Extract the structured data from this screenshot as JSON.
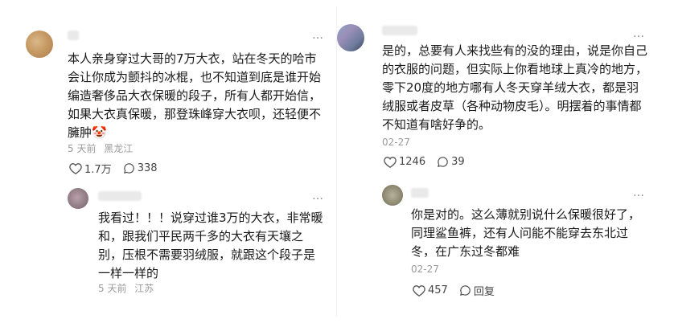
{
  "comments": [
    {
      "text": "本人亲身穿过大哥的7万大衣，站在冬天的哈市会让你成为颤抖的冰棍，也不知道到底是谁开始编造奢侈品大衣保暖的段子，所有人都开始信，如果大衣真保暖，那登珠峰穿大衣呗，还轻便不臃肿🤡",
      "time": "5 天前",
      "location": "黑龙江",
      "likes": "1.7万",
      "replies": "338"
    },
    {
      "text": "我看过！！！说穿过谁3万的大衣，非常暖和，跟我们平民两千多的大衣有天壤之别，压根不需要羽绒服，就跟这个段子是一样一样的",
      "time": "5 天前",
      "location": "江苏"
    },
    {
      "text": "是的，总要有人来找些有的没的理由，说是你自己的衣服的问题，但实际上你看地球上真冷的地方，零下20度的地方哪有人冬天穿羊绒大衣，都是羽绒服或者皮草（各种动物皮毛）。明摆着的事情都不知道有啥好争的。",
      "date": "02-27",
      "likes": "1246",
      "replies": "39"
    },
    {
      "text": "你是对的。这么薄就别说什么保暖很好了，同理鲨鱼裤，还有人问能不能穿去东北过冬，在广东过冬都难",
      "date": "02-27",
      "likes": "457",
      "reply_label": "回复"
    }
  ],
  "more_icon": "…"
}
